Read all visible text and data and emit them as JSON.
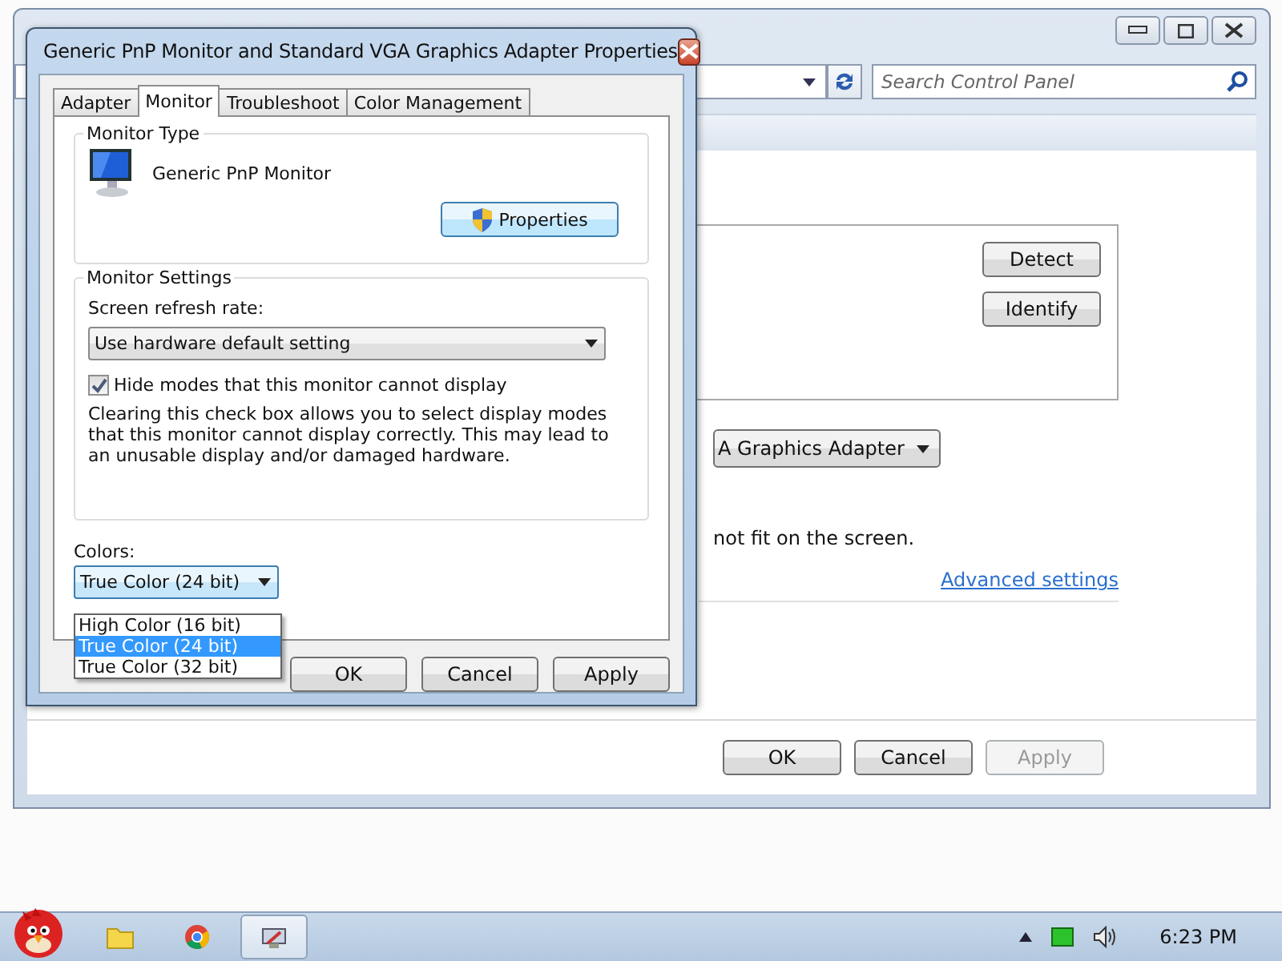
{
  "background_window": {
    "search": {
      "placeholder": "Search Control Panel"
    },
    "side_buttons": [
      "Detect",
      "Identify"
    ],
    "adapter_dropdown": {
      "value": "A Graphics Adapter"
    },
    "note": "not fit on the screen.",
    "link": "Advanced settings",
    "buttons": [
      {
        "label": "OK",
        "disabled": false
      },
      {
        "label": "Cancel",
        "disabled": false
      },
      {
        "label": "Apply",
        "disabled": true
      }
    ]
  },
  "dialog": {
    "title": "Generic PnP Monitor and Standard VGA Graphics Adapter Properties",
    "tabs": [
      {
        "label": "Adapter",
        "selected": false
      },
      {
        "label": "Monitor",
        "selected": true
      },
      {
        "label": "Troubleshoot",
        "selected": false
      },
      {
        "label": "Color Management",
        "selected": false
      }
    ],
    "monitor_type": {
      "heading": "Monitor Type",
      "name": "Generic PnP Monitor",
      "properties_button": "Properties"
    },
    "monitor_settings": {
      "heading": "Monitor Settings",
      "refresh_label": "Screen refresh rate:",
      "refresh_value": "Use hardware default setting",
      "hide_modes": {
        "label": "Hide modes that this monitor cannot display",
        "checked": true
      },
      "description": "Clearing this check box allows you to select display modes that this monitor cannot display correctly. This may lead to an unusable display and/or damaged hardware."
    },
    "colors": {
      "label": "Colors:",
      "value": "True Color (24 bit)",
      "expanded": true,
      "options": [
        {
          "label": "High Color (16 bit)",
          "selected": false
        },
        {
          "label": "True Color (24 bit)",
          "selected": true
        },
        {
          "label": "True Color (32 bit)",
          "selected": false
        }
      ]
    },
    "buttons": [
      {
        "label": "OK",
        "disabled": false
      },
      {
        "label": "Cancel",
        "disabled": false
      },
      {
        "label": "Apply",
        "disabled": false
      }
    ]
  },
  "taskbar": {
    "items": [
      {
        "kind": "folder",
        "selected": false
      },
      {
        "kind": "browser",
        "selected": false
      },
      {
        "kind": "display",
        "selected": true
      }
    ],
    "clock": "6:23 PM"
  }
}
